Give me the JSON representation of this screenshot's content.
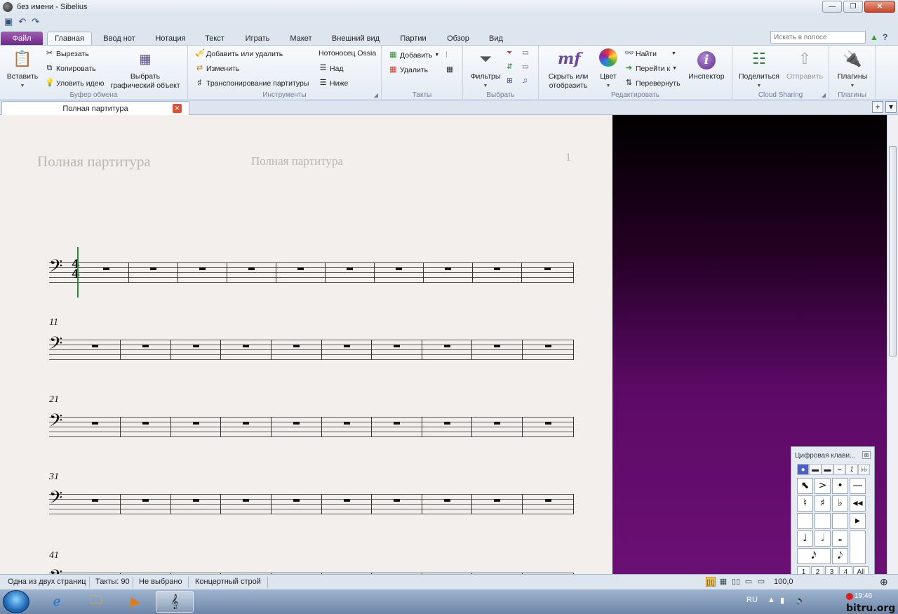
{
  "window": {
    "title": "без имени - Sibelius"
  },
  "colors": {
    "file_tab": "#7a3592",
    "page": "#f3efec",
    "workspace_bottom": "#6b0f74",
    "caret": "#2c8c3c",
    "keypad_active": "#4a5fc8"
  },
  "tabs": [
    {
      "label": "Файл"
    },
    {
      "label": "Главная"
    },
    {
      "label": "Ввод нот"
    },
    {
      "label": "Нотация"
    },
    {
      "label": "Текст"
    },
    {
      "label": "Играть"
    },
    {
      "label": "Макет"
    },
    {
      "label": "Внешний вид"
    },
    {
      "label": "Партии"
    },
    {
      "label": "Обзор"
    },
    {
      "label": "Вид"
    }
  ],
  "ribbon_search": {
    "placeholder": "Искать в полосе"
  },
  "ribbon": {
    "clipboard": {
      "label": "Буфер обмена",
      "paste": "Вставить",
      "cut": "Вырезать",
      "copy": "Копировать",
      "capture": "Уловить идею",
      "select_graphic_1": "Выбрать",
      "select_graphic_2": "графический объект"
    },
    "instruments": {
      "label": "Инструменты",
      "add_remove": "Добавить или удалить",
      "change": "Изменить",
      "transpose": "Транспонирование партитуры",
      "ossia": "Нотоносец Ossia",
      "above": "Над",
      "below": "Ниже"
    },
    "bars": {
      "label": "Такты",
      "add": "Добавить",
      "delete": "Удалить"
    },
    "select": {
      "label": "Выбрать",
      "filters": "Фильтры"
    },
    "edit": {
      "label": "Редактировать",
      "hide_show_1": "Скрыть или",
      "hide_show_2": "отобразить",
      "color": "Цвет",
      "find": "Найти",
      "goto": "Перейти к",
      "flip": "Перевернуть",
      "inspector": "Инспектор"
    },
    "cloud": {
      "label": "Cloud Sharing",
      "share": "Поделиться",
      "send": "Отправить"
    },
    "plugins": {
      "label": "Плагины",
      "plugins": "Плагины"
    }
  },
  "document_tab": {
    "label": "Полная партитура"
  },
  "score": {
    "header_left": "Полная партитура",
    "header_center": "Полная партитура",
    "page_number": "1",
    "clef": "𝄢",
    "time_sig_top": "4",
    "time_sig_bottom": "4",
    "bar_numbers": [
      "11",
      "21",
      "31",
      "41"
    ]
  },
  "keypad": {
    "title": "Цифровая клави...",
    "tabs": [
      "●",
      "▬",
      "▬",
      "⌢",
      "⁒",
      "♭♭"
    ],
    "keys": [
      "⬉",
      ">",
      "•",
      "—",
      "♮",
      "♯",
      "♭",
      "◂◂",
      "",
      "",
      "",
      "▸",
      "♩",
      "𝅗𝅥",
      "𝅝",
      "",
      "𝅘𝅥𝅯",
      "𝅘𝅥𝅮",
      "♪",
      "⌢",
      "𝄽𝄾",
      ".",
      ""
    ],
    "layouts": [
      "1",
      "2",
      "3",
      "4",
      "All"
    ]
  },
  "status": {
    "pages": "Одна из двух страниц",
    "bars": "Такты: 90",
    "selection": "Не выбрано",
    "pitch": "Концертный строй",
    "zoom": "100,0"
  },
  "taskbar": {
    "lang": "RU",
    "time": "19:46",
    "watermark": "bitru.org"
  }
}
